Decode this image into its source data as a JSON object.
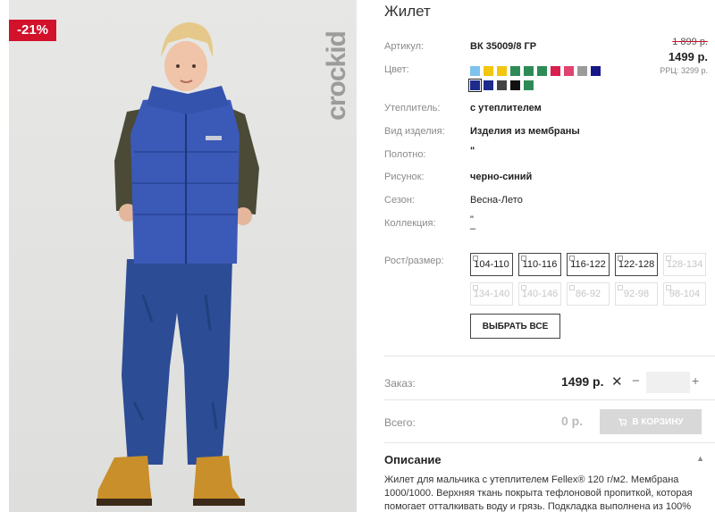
{
  "badge": {
    "discount": "-21%"
  },
  "brand": {
    "logo": "crockid"
  },
  "product": {
    "title": "Жилет"
  },
  "specs": [
    {
      "label": "Артикул:",
      "value": "ВК 35009/8 ГР"
    },
    {
      "label": "Цвет:",
      "value": ""
    },
    {
      "label": "Утеплитель:",
      "value": "с утеплителем"
    },
    {
      "label": "Вид изделия:",
      "value": "Изделия из мембраны"
    },
    {
      "label": "Полотно:",
      "value": "\""
    },
    {
      "label": "Рисунок:",
      "value": "черно-синий"
    },
    {
      "label": "Сезон:",
      "value": "Весна-Лето"
    },
    {
      "label": "Коллекция:",
      "value": "\""
    }
  ],
  "collection_extra": "–",
  "price": {
    "old": "1 899 р.",
    "current": "1499 р.",
    "rrp": "РРЦ: 3299 р."
  },
  "colors": {
    "row1": [
      "#7ec3ec",
      "#f3c60f",
      "#f3c60f",
      "#2e8b57",
      "#2e8b57",
      "#2e8b57",
      "#d81f4e",
      "#e0436f",
      "#9b9b9b",
      "#17178a"
    ],
    "row2": [
      "#1c2b8c",
      "#1c2b8c",
      "#444444",
      "#111111",
      "#2e8b57"
    ],
    "selected_index": 0
  },
  "sizes": {
    "label": "Рост/размер:",
    "row1": [
      {
        "label": "104-110",
        "available": true
      },
      {
        "label": "110-116",
        "available": true
      },
      {
        "label": "116-122",
        "available": true
      },
      {
        "label": "122-128",
        "available": true
      },
      {
        "label": "128-134",
        "available": false
      }
    ],
    "row2": [
      {
        "label": "134-140",
        "available": false
      },
      {
        "label": "140-146",
        "available": false
      },
      {
        "label": "86-92",
        "available": false
      },
      {
        "label": "92-98",
        "available": false
      },
      {
        "label": "98-104",
        "available": false
      }
    ],
    "select_all": "ВЫБРАТЬ ВСЕ"
  },
  "order": {
    "label": "Заказ:",
    "price": "1499 р.",
    "times": "✕",
    "minus": "−",
    "plus": "+",
    "qty": ""
  },
  "total": {
    "label": "Всего:",
    "price": "0 р.",
    "cart_button": "В КОРЗИНУ"
  },
  "description": {
    "title": "Описание",
    "text": "Жилет для мальчика с утеплителем Fellex® 120 г/м2. Мембрана 1000/1000. Верхняя ткань покрыта тефлоновой пропиткой, которая помогает отталкивать воду и грязь. Подкладка выполнена из 100%"
  }
}
